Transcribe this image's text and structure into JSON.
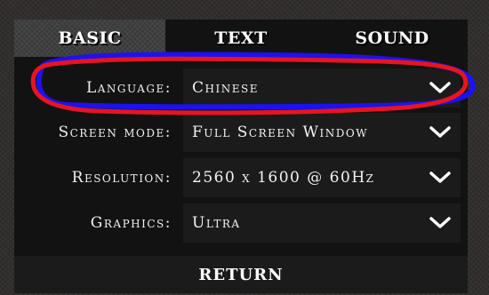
{
  "tabs": [
    {
      "label": "BASIC",
      "active": true
    },
    {
      "label": "TEXT",
      "active": false
    },
    {
      "label": "SOUND",
      "active": false
    }
  ],
  "settings": [
    {
      "label": "Language:",
      "value": "Chinese",
      "icon": "chevron-down-icon"
    },
    {
      "label": "Screen mode:",
      "value": "Full Screen Window",
      "icon": "chevron-down-icon"
    },
    {
      "label": "Resolution:",
      "value": "2560 x 1600 @ 60Hz",
      "icon": "chevron-down-icon"
    },
    {
      "label": "Graphics:",
      "value": "Ultra",
      "icon": "chevron-down-icon"
    }
  ],
  "footer": {
    "return_label": "RETURN"
  },
  "colors": {
    "background": "#2e2b2a",
    "panel": "#121212",
    "row": "#1b1b1b",
    "highlight_red": "#e8141f",
    "highlight_blue": "#1b12f2"
  }
}
